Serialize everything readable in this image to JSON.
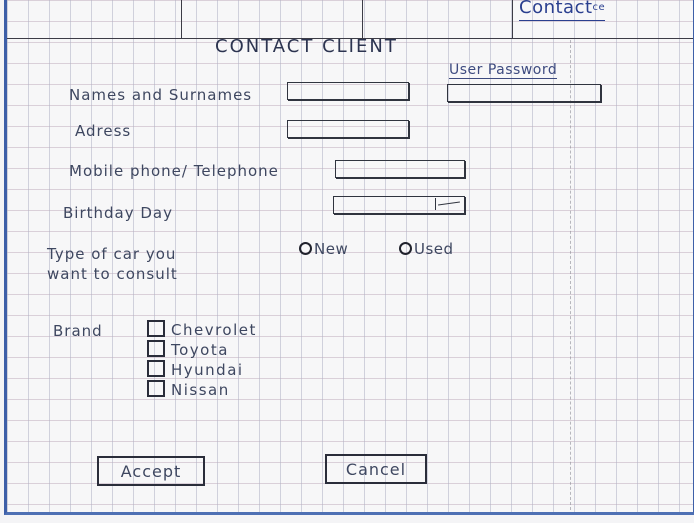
{
  "tab": {
    "label": "Contact",
    "icon_text": "ce"
  },
  "form": {
    "title": "CONTACT CLIENT",
    "password_label": "User Password",
    "fields": {
      "names_label": "Names and Surnames",
      "address_label": "Adress",
      "phone_label": "Mobile phone/ Telephone",
      "birthday_label": "Birthday Day"
    },
    "car_type": {
      "label_line1": "Type of car you",
      "label_line2": "want to consult",
      "options": [
        "New",
        "Used"
      ]
    },
    "brand": {
      "label": "Brand",
      "options": [
        "Chevrolet",
        "Toyota",
        "Hyundai",
        "Nissan"
      ]
    },
    "buttons": {
      "accept": "Accept",
      "cancel": "Cancel"
    }
  }
}
